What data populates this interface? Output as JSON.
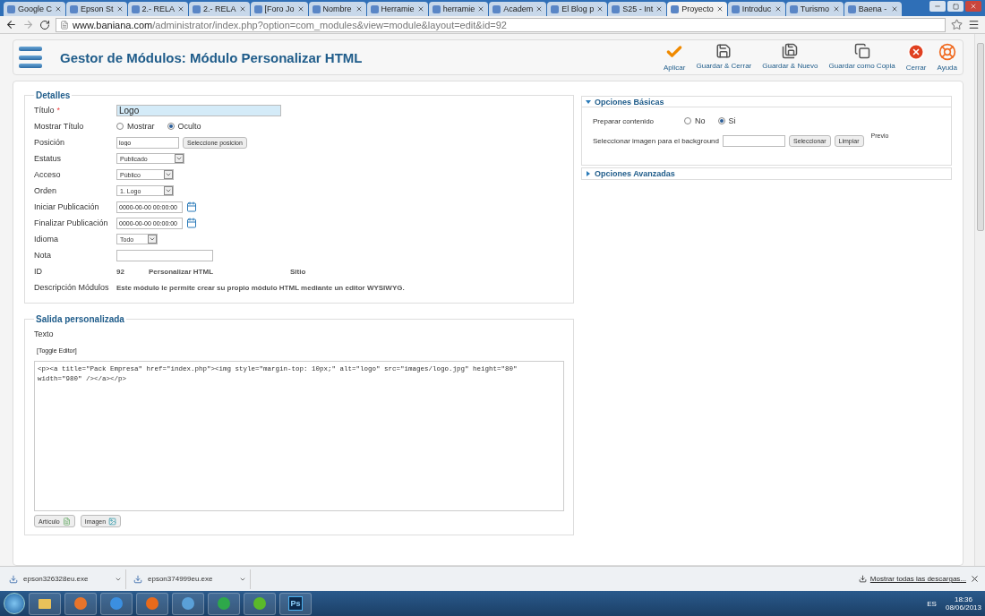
{
  "browser": {
    "tabs": [
      {
        "label": "Google C",
        "selected": false
      },
      {
        "label": "Epson St",
        "selected": false
      },
      {
        "label": "2.- RELA",
        "selected": false
      },
      {
        "label": "2.- RELA",
        "selected": false
      },
      {
        "label": "[Foro Jo",
        "selected": false
      },
      {
        "label": "Nombre",
        "selected": false
      },
      {
        "label": "Herramie",
        "selected": false
      },
      {
        "label": "herramie",
        "selected": false
      },
      {
        "label": "Academ",
        "selected": false
      },
      {
        "label": "El Blog p",
        "selected": false
      },
      {
        "label": "S25 - Int",
        "selected": false
      },
      {
        "label": "Proyecto",
        "selected": true
      },
      {
        "label": "Introduc",
        "selected": false
      },
      {
        "label": "Turismo",
        "selected": false
      },
      {
        "label": "Baena - ",
        "selected": false
      }
    ],
    "url_host": "www.baniana.com",
    "url_path": "/administrator/index.php?option=com_modules&view=module&layout=edit&id=92"
  },
  "header": {
    "title": "Gestor de Módulos: Módulo Personalizar HTML",
    "toolbar": [
      {
        "kind": "apply",
        "label": "Aplicar"
      },
      {
        "kind": "save",
        "label": "Guardar & Cerrar"
      },
      {
        "kind": "save_new",
        "label": "Guardar & Nuevo"
      },
      {
        "kind": "save_copy",
        "label": "Guardar como Copia"
      },
      {
        "kind": "close",
        "label": "Cerrar"
      },
      {
        "kind": "help",
        "label": "Ayuda"
      }
    ]
  },
  "details": {
    "legend": "Detalles",
    "fields": [
      {
        "kind": "text",
        "label": "Título",
        "mark": "*",
        "value": "Logo",
        "highlighted": true
      },
      {
        "kind": "radio",
        "label": "Mostrar Título",
        "options": [
          {
            "label": "Mostrar",
            "selected": false
          },
          {
            "label": "Oculto",
            "selected": true
          }
        ]
      },
      {
        "kind": "text_button",
        "label": "Posición",
        "value": "logo",
        "button": "Seleccione posicion"
      },
      {
        "kind": "select",
        "label": "Estatus",
        "value": "Publicado"
      },
      {
        "kind": "select",
        "label": "Acceso",
        "value": "Público"
      },
      {
        "kind": "select",
        "label": "Orden",
        "value": "1. Logo"
      },
      {
        "kind": "date",
        "label": "Iniciar Publicación",
        "value": "0000-00-00 00:00:00"
      },
      {
        "kind": "date",
        "label": "Finalizar Publicación",
        "value": "0000-00-00 00:00:00"
      },
      {
        "kind": "select",
        "label": "Idioma",
        "value": "Todo"
      },
      {
        "kind": "text",
        "label": "Nota",
        "highlighted": false
      },
      {
        "kind": "info",
        "label": "ID",
        "parts": [
          "92",
          "Personalizar HTML",
          "Sitio"
        ]
      },
      {
        "kind": "description",
        "label": "Descripción Módulos",
        "text": "Este módulo le permite crear su propio módulo HTML mediante un editor WYSIWYG."
      }
    ]
  },
  "custom_output": {
    "legend": "Salida personalizada",
    "label": "Texto",
    "toggle": "[Toggle Editor]",
    "code": "<p><a title=\"Pack Empresa\" href=\"index.php\"><img style=\"margin-top: 10px;\" alt=\"logo\" src=\"images/logo.jpg\" height=\"80\" width=\"980\" /></a></p>",
    "buttons": [
      {
        "kind": "article",
        "label": "Artículo"
      },
      {
        "kind": "image",
        "label": "Imagen"
      }
    ]
  },
  "panels": [
    {
      "title": "Opciones Básicas",
      "expanded": true,
      "radio": {
        "label": "Preparar contenido",
        "options": [
          {
            "label": "No",
            "selected": false
          },
          {
            "label": "Si",
            "selected": true
          }
        ]
      },
      "image": {
        "label": "Seleccionar imagen para el background",
        "select": "Seleccionar",
        "clear": "Limpiar",
        "preview": "Previo"
      }
    },
    {
      "title": "Opciones Avanzadas",
      "expanded": false
    }
  ],
  "downloads": {
    "items": [
      "epson326328eu.exe",
      "epson374999eu.exe"
    ],
    "show_all": "Mostrar todas las descargas..."
  },
  "taskbar": {
    "apps": [
      {
        "kind": "folder"
      },
      {
        "kind": "media"
      },
      {
        "kind": "ie"
      },
      {
        "kind": "firefox"
      },
      {
        "kind": "tool"
      },
      {
        "kind": "chrome"
      },
      {
        "kind": "spotify"
      },
      {
        "kind": "ps",
        "label": "Ps"
      }
    ],
    "language": "ES",
    "time": "18:36",
    "date": "08/06/2013"
  }
}
